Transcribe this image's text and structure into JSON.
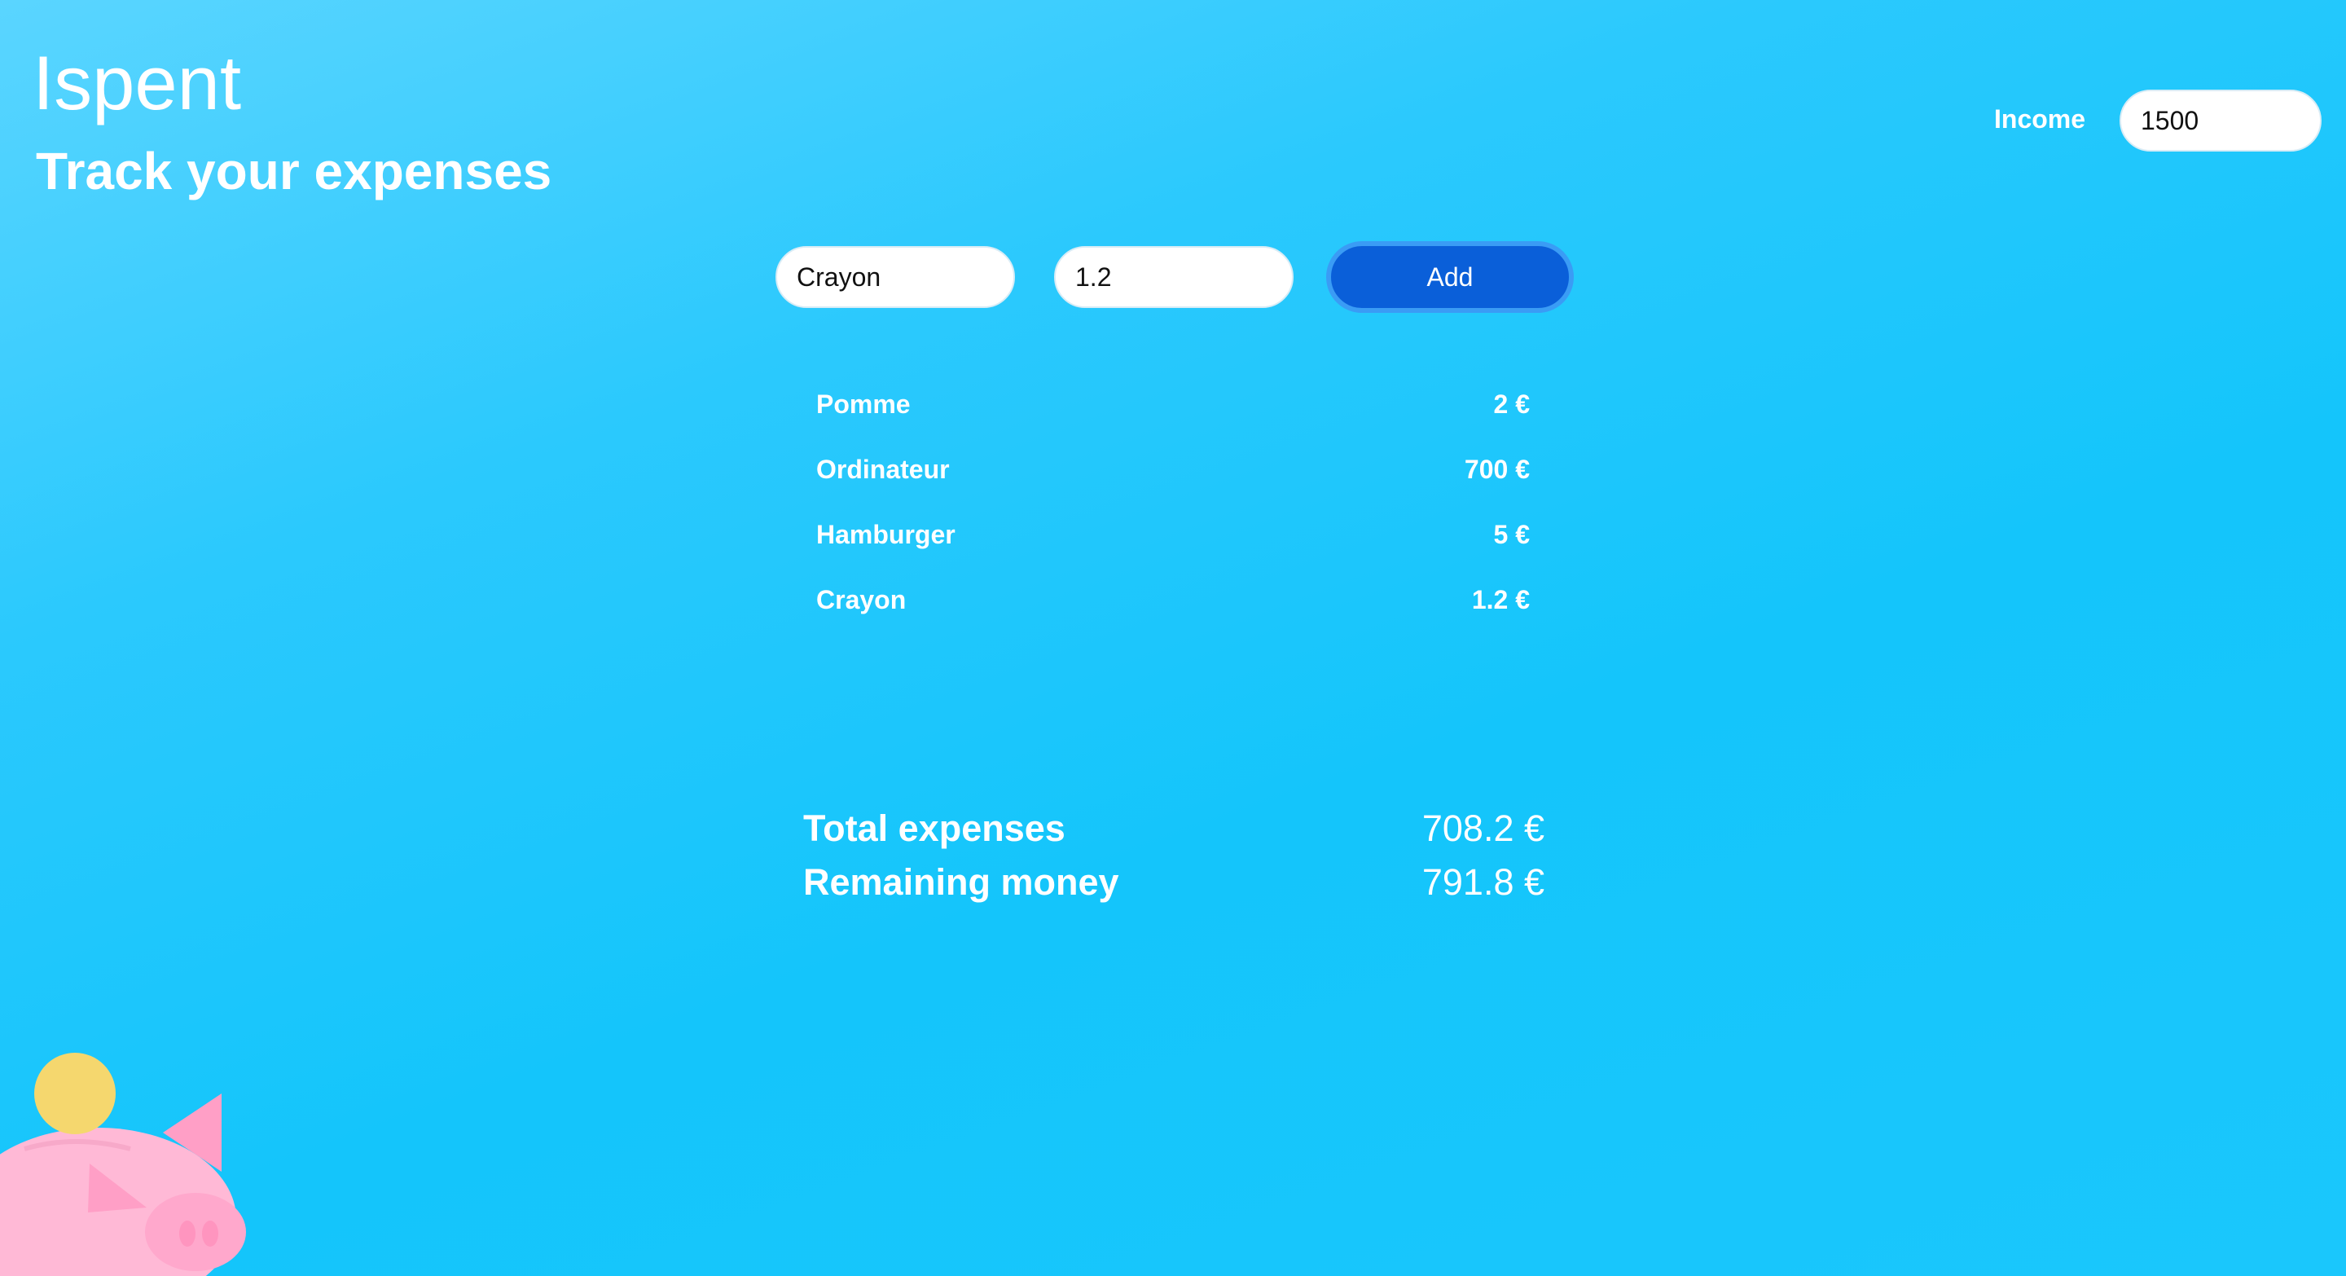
{
  "header": {
    "title": "Ispent",
    "subtitle": "Track your expenses"
  },
  "income": {
    "label": "Income",
    "value": "1500"
  },
  "form": {
    "name_value": "Crayon",
    "amount_value": "1.2",
    "add_label": "Add"
  },
  "expenses": [
    {
      "name": "Pomme",
      "amount": "2 €"
    },
    {
      "name": "Ordinateur",
      "amount": "700 €"
    },
    {
      "name": "Hamburger",
      "amount": "5 €"
    },
    {
      "name": "Crayon",
      "amount": "1.2 €"
    }
  ],
  "summary": {
    "total_label": "Total expenses",
    "total_value": "708.2 €",
    "remaining_label": "Remaining money",
    "remaining_value": "791.8 €"
  },
  "colors": {
    "background": "#14c5fb",
    "button": "#0a5fd9",
    "coin": "#f5d76e",
    "pig": "#ffb9d6"
  },
  "icons": {
    "mascot": "piggy-bank-icon"
  }
}
